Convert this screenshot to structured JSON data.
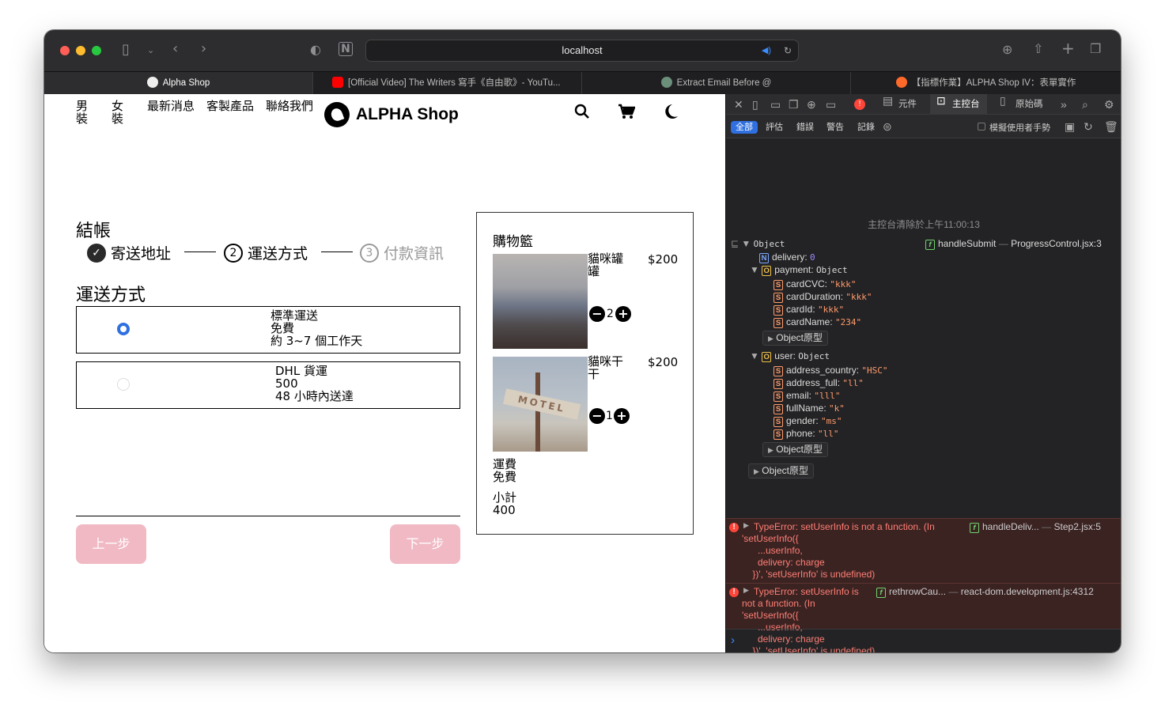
{
  "browser": {
    "url": "localhost",
    "tabs": [
      {
        "label": "Alpha Shop"
      },
      {
        "label": "[Official Video] The Writers 寫手《自由歌》- YouTu..."
      },
      {
        "label": "Extract Email Before @"
      },
      {
        "label": "【指標作業】ALPHA Shop IV：表單實作"
      }
    ]
  },
  "shop": {
    "nav": [
      "男裝",
      "女裝",
      "最新消息",
      "客製產品",
      "聯絡我們"
    ],
    "brand": "ALPHA Shop",
    "checkout_title": "結帳",
    "steps": [
      {
        "num": "✓",
        "label": "寄送地址"
      },
      {
        "num": "2",
        "label": "運送方式"
      },
      {
        "num": "3",
        "label": "付款資訊"
      }
    ],
    "section_title": "運送方式",
    "shipping_options": [
      {
        "name": "標準運送",
        "price": "免費",
        "time": "約 3~7 個工作天",
        "selected": true
      },
      {
        "name": "DHL 貨運",
        "price": "500",
        "time": "48 小時內送達",
        "selected": false
      }
    ],
    "prev_button": "上一步",
    "next_button": "下一步",
    "cart": {
      "title": "購物籃",
      "items": [
        {
          "name": "貓咪罐罐",
          "price": "$200",
          "qty": "2"
        },
        {
          "name": "貓咪干干",
          "price": "$200",
          "qty": "1"
        }
      ],
      "shipping_label": "運費",
      "shipping_value": "免費",
      "subtotal_label": "小計",
      "subtotal_value": "400"
    }
  },
  "devtools": {
    "tabs": [
      "元件",
      "主控台",
      "原始碼"
    ],
    "filters": [
      "全部",
      "評估",
      "錯誤",
      "警告",
      "記錄"
    ],
    "simulate_gesture": "模擬使用者手勢",
    "cleared_message": "主控台清除於上午11:00:13",
    "log": {
      "root": "Object",
      "func": "handleSubmit",
      "source": "ProgressControl.jsx:3",
      "delivery_key": "delivery:",
      "delivery_value": "0",
      "payment_key": "payment:",
      "payment_type": "Object",
      "payment_fields": [
        {
          "key": "cardCVC:",
          "value": "\"kkk\""
        },
        {
          "key": "cardDuration:",
          "value": "\"kkk\""
        },
        {
          "key": "cardId:",
          "value": "\"kkk\""
        },
        {
          "key": "cardName:",
          "value": "\"234\""
        }
      ],
      "prototype_label": "Object原型",
      "user_key": "user:",
      "user_type": "Object",
      "user_fields": [
        {
          "key": "address_country:",
          "value": "\"HSC\""
        },
        {
          "key": "address_full:",
          "value": "\"ll\""
        },
        {
          "key": "email:",
          "value": "\"lll\""
        },
        {
          "key": "fullName:",
          "value": "\"k\""
        },
        {
          "key": "gender:",
          "value": "\"ms\""
        },
        {
          "key": "phone:",
          "value": "\"ll\""
        }
      ]
    },
    "errors": [
      {
        "lines": [
          "TypeError: setUserInfo is not a function. (In",
          "'setUserInfo({",
          "      ...userInfo,",
          "      delivery: charge",
          "    })', 'setUserInfo' is undefined)"
        ],
        "func": "handleDeliv...",
        "source": "Step2.jsx:5"
      },
      {
        "lines": [
          "TypeError: setUserInfo is",
          "not a function. (In",
          "'setUserInfo({",
          "      ...userInfo,",
          "      delivery: charge",
          "    })', 'setUserInfo' is undefined)"
        ],
        "func": "rethrowCau...",
        "source": "react-dom.development.js:4312"
      }
    ]
  },
  "colors": {
    "accent_blue": "#2f6fe0",
    "button_pink": "#f0b9c4",
    "error_red": "#ff453a"
  }
}
